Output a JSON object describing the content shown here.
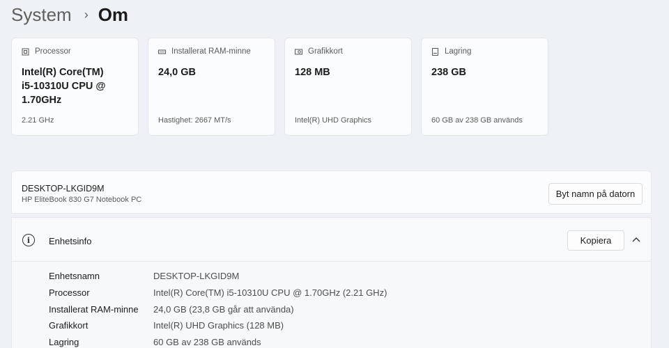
{
  "breadcrumb": {
    "parent": "System",
    "separator": "›",
    "current": "Om"
  },
  "cards": [
    {
      "icon": "processor-icon",
      "title": "Processor",
      "value": "Intel(R) Core(TM) i5-10310U CPU @ 1.70GHz",
      "sub": "2.21 GHz"
    },
    {
      "icon": "ram-icon",
      "title": "Installerat RAM-minne",
      "value": "24,0 GB",
      "sub": "Hastighet: 2667 MT/s"
    },
    {
      "icon": "graphics-card-icon",
      "title": "Grafikkort",
      "value": "128 MB",
      "sub": "Intel(R) UHD Graphics"
    },
    {
      "icon": "storage-icon",
      "title": "Lagring",
      "value": "238 GB",
      "sub": "60 GB av 238 GB används"
    }
  ],
  "device": {
    "name": "DESKTOP-LKGID9M",
    "model": "HP EliteBook 830 G7 Notebook PC",
    "rename_label": "Byt namn på datorn"
  },
  "device_info": {
    "title": "Enhetsinfo",
    "copy_label": "Kopiera",
    "specs": [
      {
        "label": "Enhetsnamn",
        "value": "DESKTOP-LKGID9M"
      },
      {
        "label": "Processor",
        "value": "Intel(R) Core(TM) i5-10310U CPU @ 1.70GHz (2.21 GHz)"
      },
      {
        "label": "Installerat RAM-minne",
        "value": "24,0 GB (23,8 GB går att använda)"
      },
      {
        "label": "Grafikkort",
        "value": "Intel(R) UHD Graphics (128 MB)"
      },
      {
        "label": "Lagring",
        "value": "60 GB av 238 GB används"
      }
    ]
  }
}
